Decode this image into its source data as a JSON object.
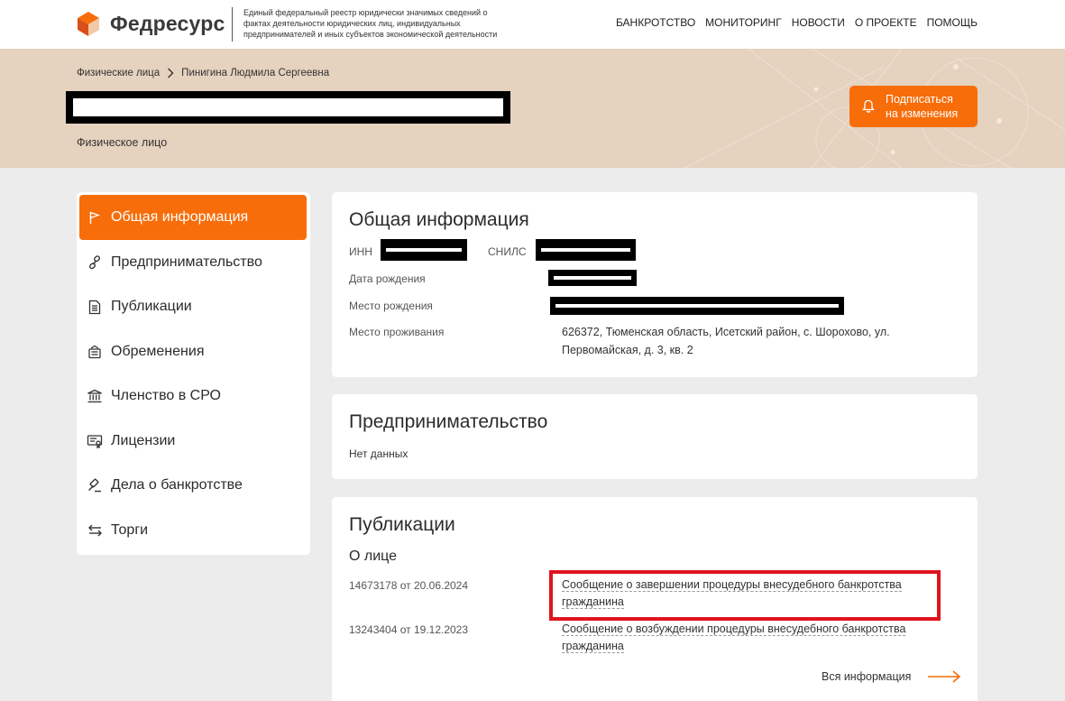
{
  "header": {
    "logo_title": "Федресурс",
    "logo_desc": "Единый федеральный реестр юридически значимых сведений о фактах деятельности юридических лиц, индивидуальных предпринимателей и иных субъектов экономической деятельности",
    "nav": [
      "БАНКРОТСТВО",
      "МОНИТОРИНГ",
      "НОВОСТИ",
      "О ПРОЕКТЕ",
      "ПОМОЩЬ"
    ]
  },
  "banner": {
    "breadcrumb_root": "Физические лица",
    "breadcrumb_current": "Пинигина Людмила Сергеевна",
    "person_type": "Физическое лицо",
    "subscribe_label": "Подписаться на изменения",
    "subscribe_line1": "Подписаться",
    "subscribe_line2": "на изменения"
  },
  "sidebar": {
    "items": [
      {
        "label": "Общая информация",
        "icon": "flag-icon"
      },
      {
        "label": "Предпринимательство",
        "icon": "link-icon"
      },
      {
        "label": "Публикации",
        "icon": "document-icon"
      },
      {
        "label": "Обременения",
        "icon": "stack-icon"
      },
      {
        "label": "Членство в СРО",
        "icon": "institution-icon"
      },
      {
        "label": "Лицензии",
        "icon": "certificate-icon"
      },
      {
        "label": "Дела о банкротстве",
        "icon": "gavel-icon"
      },
      {
        "label": "Торги",
        "icon": "exchange-icon"
      }
    ]
  },
  "general": {
    "title": "Общая информация",
    "inn_label": "ИНН",
    "snils_label": "СНИЛС",
    "birth_date_label": "Дата рождения",
    "birth_place_label": "Место рождения",
    "residence_label": "Место проживания",
    "residence_value": "626372, Тюменская область, Исетский район, с. Шорохово, ул. Первомайская, д. 3, кв. 2"
  },
  "business": {
    "title": "Предпринимательство",
    "no_data": "Нет данных"
  },
  "publications": {
    "title": "Публикации",
    "subtitle": "О лице",
    "items": [
      {
        "ref": "14673178 от 20.06.2024",
        "text": "Сообщение о завершении процедуры внесудебного банкротства гражданина"
      },
      {
        "ref": "13243404 от 19.12.2023",
        "text": "Сообщение о возбуждении процедуры внесудебного банкротства гражданина"
      }
    ],
    "all_link": "Вся информация"
  },
  "colors": {
    "accent": "#f76d0a",
    "highlight": "#e0141e",
    "banner": "#e5d2bf"
  }
}
